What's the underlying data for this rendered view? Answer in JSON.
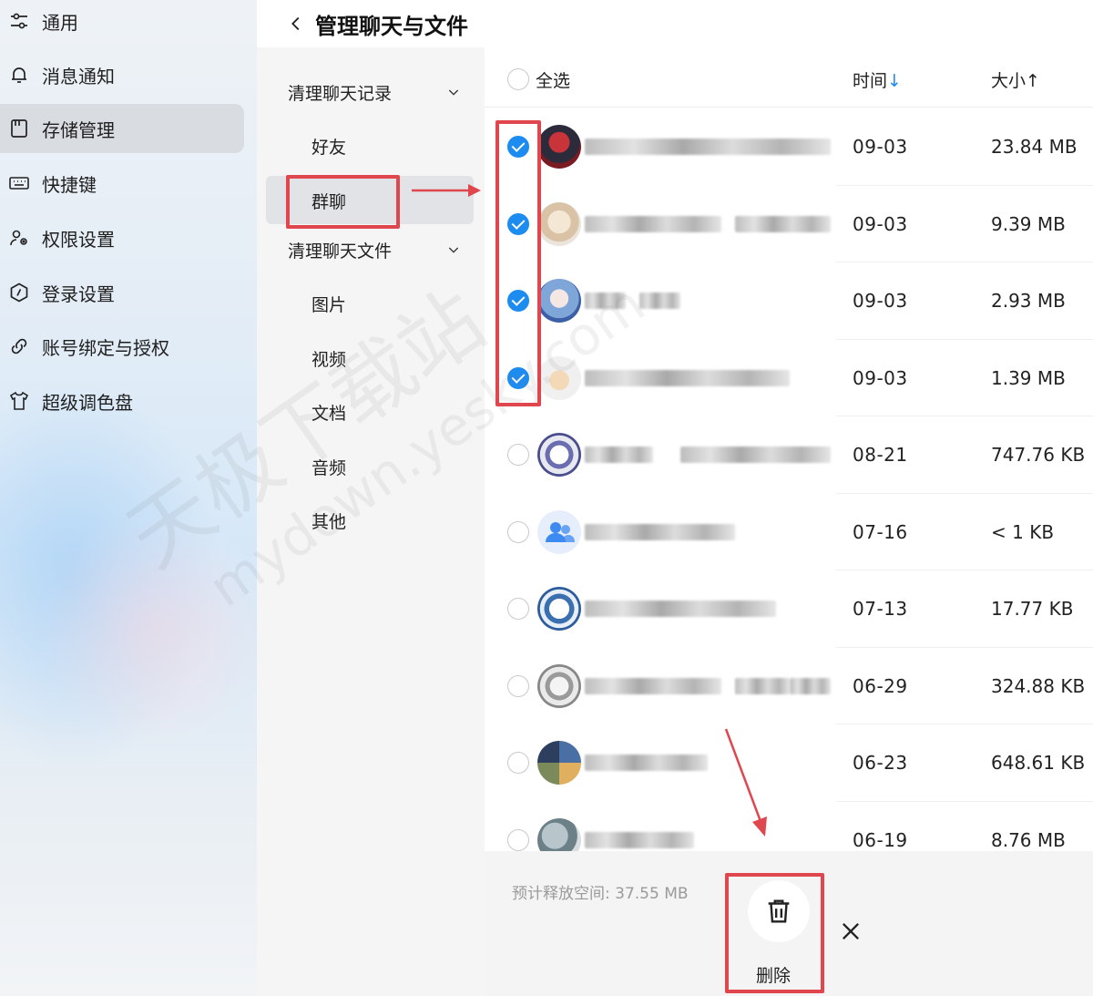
{
  "sidebar": {
    "items": [
      {
        "label": "通用",
        "icon": "sliders-icon"
      },
      {
        "label": "消息通知",
        "icon": "bell-icon"
      },
      {
        "label": "存储管理",
        "icon": "storage-icon",
        "active": true
      },
      {
        "label": "快捷键",
        "icon": "keyboard-icon"
      },
      {
        "label": "权限设置",
        "icon": "users-icon"
      },
      {
        "label": "登录设置",
        "icon": "shield-icon"
      },
      {
        "label": "账号绑定与授权",
        "icon": "link-icon"
      },
      {
        "label": "超级调色盘",
        "icon": "tshirt-icon"
      }
    ]
  },
  "header": {
    "title": "管理聊天与文件"
  },
  "midnav": {
    "section1": "清理聊天记录",
    "friends": "好友",
    "groups": "群聊",
    "section2": "清理聊天文件",
    "images": "图片",
    "videos": "视频",
    "docs": "文档",
    "audio": "音频",
    "others": "其他"
  },
  "list": {
    "select_all": "全选",
    "col_time": "时间",
    "col_time_arrow": "↓",
    "col_size": "大小↑",
    "rows": [
      {
        "date": "09-03",
        "size": "23.84 MB",
        "checked": true
      },
      {
        "date": "09-03",
        "size": "9.39 MB",
        "checked": true
      },
      {
        "date": "09-03",
        "size": "2.93 MB",
        "checked": true
      },
      {
        "date": "09-03",
        "size": "1.39 MB",
        "checked": true
      },
      {
        "date": "08-21",
        "size": "747.76 KB",
        "checked": false
      },
      {
        "date": "07-16",
        "size": "< 1 KB",
        "checked": false
      },
      {
        "date": "07-13",
        "size": "17.77 KB",
        "checked": false
      },
      {
        "date": "06-29",
        "size": "324.88 KB",
        "checked": false
      },
      {
        "date": "06-23",
        "size": "648.61 KB",
        "checked": false
      },
      {
        "date": "06-19",
        "size": "8.76 MB",
        "checked": false
      }
    ]
  },
  "footer": {
    "free_space": "预计释放空间: 37.55 MB",
    "delete_label": "删除"
  },
  "watermark": {
    "line1": "天极下载站",
    "line2": "mydown.yesky.com"
  },
  "colors": {
    "accent": "#1d8cf0",
    "highlight": "#e0464e"
  }
}
